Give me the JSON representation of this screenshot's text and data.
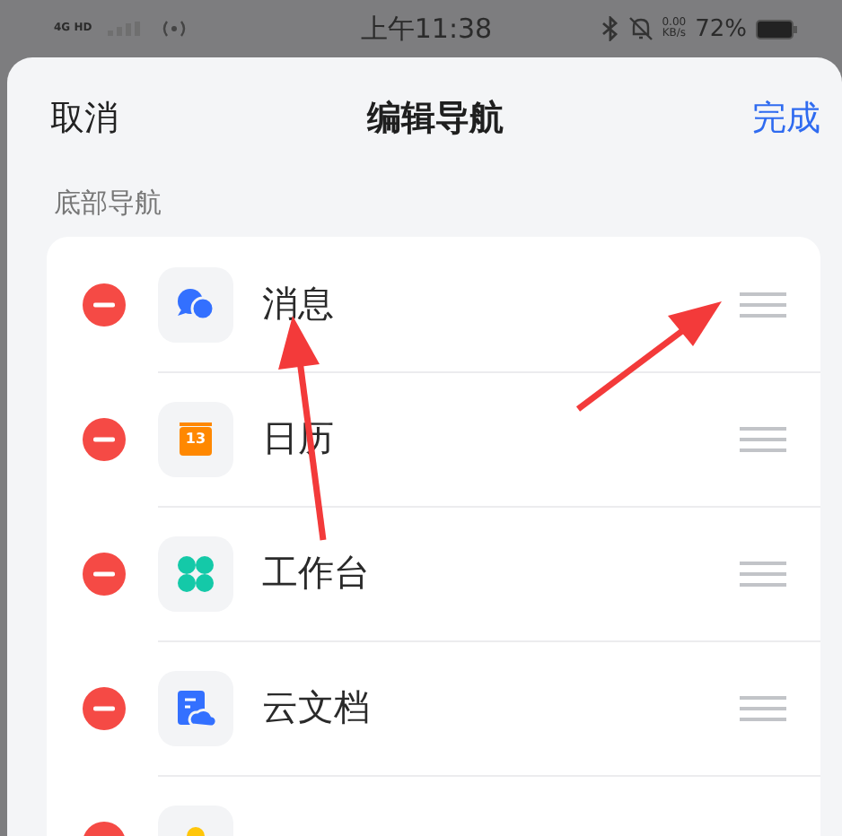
{
  "status_bar": {
    "network": "4G HD",
    "time": "上午11:38",
    "speed": "0.00",
    "speed_unit": "KB/s",
    "battery": "72%"
  },
  "header": {
    "cancel": "取消",
    "title": "编辑导航",
    "done": "完成"
  },
  "section": {
    "title": "底部导航",
    "items": [
      {
        "label": "消息",
        "kind": "chat",
        "label_arrow": true,
        "handle_arrow": true
      },
      {
        "label": "日历",
        "kind": "calendar",
        "icon_text": "13",
        "label_arrow": false,
        "handle_arrow": false
      },
      {
        "label": "工作台",
        "kind": "workspace",
        "label_arrow": false,
        "handle_arrow": false
      },
      {
        "label": "云文档",
        "kind": "docs",
        "label_arrow": false,
        "handle_arrow": false
      },
      {
        "kind": "contacts"
      }
    ]
  }
}
